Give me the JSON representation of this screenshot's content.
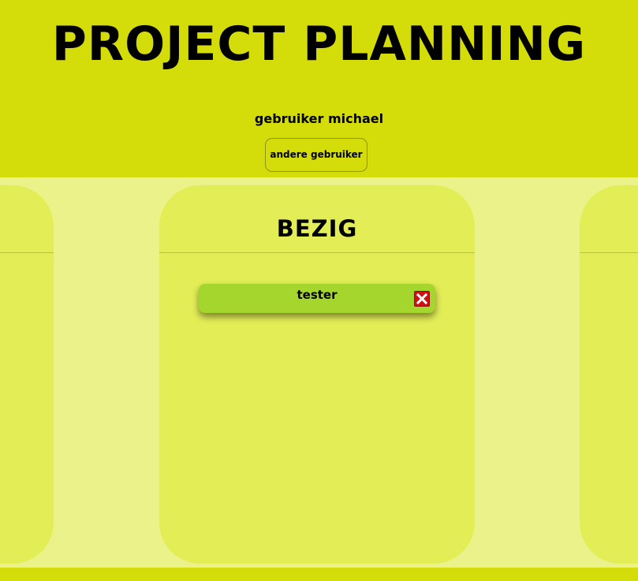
{
  "header": {
    "title": "PROJECT PLANNING",
    "user_label": "gebruiker michael",
    "switch_user_button": "andere gebruiker"
  },
  "columns": [
    {
      "title": ""
    },
    {
      "title": "BEZIG",
      "tasks": [
        {
          "title": "tester",
          "delete_icon": "close-icon"
        }
      ]
    },
    {
      "title": ""
    }
  ],
  "colors": {
    "header_bg": "#d4dc0a",
    "board_bg": "#ecf28a",
    "column_bg": "#e3ee56",
    "task_bg": "#a4d62e",
    "delete_bg": "#d20f12"
  }
}
